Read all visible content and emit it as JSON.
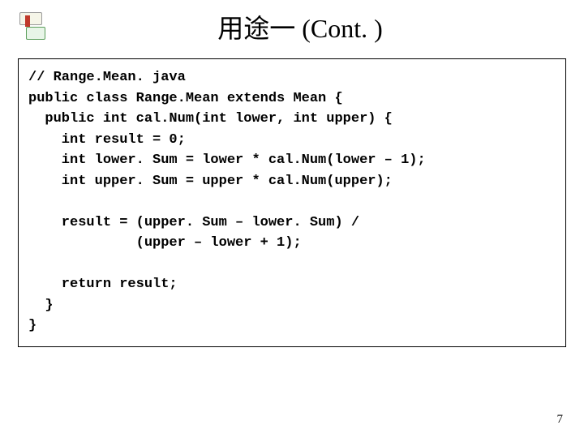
{
  "title": "用途一 (Cont. )",
  "code": {
    "l1": "// Range.Mean. java",
    "l2": "public class Range.Mean extends Mean {",
    "l3": "  public int cal.Num(int lower, int upper) {",
    "l4": "    int result = 0;",
    "l5": "    int lower. Sum = lower * cal.Num(lower – 1);",
    "l6": "    int upper. Sum = upper * cal.Num(upper);",
    "l7": "",
    "l8": "    result = (upper. Sum – lower. Sum) /",
    "l9": "             (upper – lower + 1);",
    "l10": "",
    "l11": "    return result;",
    "l12": "  }",
    "l13": "}"
  },
  "page_number": "7"
}
